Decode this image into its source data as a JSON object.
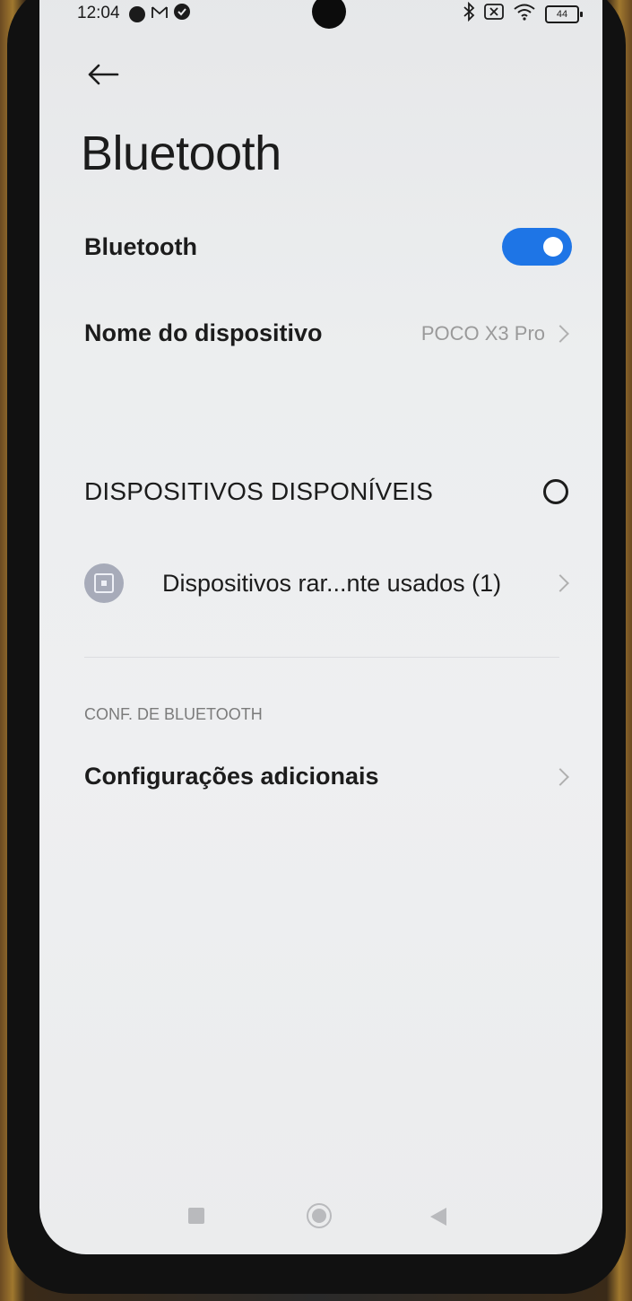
{
  "status_bar": {
    "time": "12:04",
    "battery": "44",
    "icons": [
      "notification-circle-icon",
      "gmail-icon",
      "check-circle-icon",
      "bluetooth-icon",
      "no-sim-icon",
      "wifi-icon",
      "battery-icon"
    ]
  },
  "header": {
    "back_icon": "back-arrow-icon",
    "title": "Bluetooth"
  },
  "bluetooth_row": {
    "label": "Bluetooth",
    "toggle_on": true,
    "toggle_color": "#1e75e6"
  },
  "device_name_row": {
    "label": "Nome do dispositivo",
    "value": "POCO X3 Pro"
  },
  "available_section": {
    "title": "DISPOSITIVOS DISPONÍVEIS",
    "device_item": {
      "label": "Dispositivos rar...nte usados (1)"
    }
  },
  "settings_section": {
    "title": "CONF. DE BLUETOOTH",
    "items": [
      {
        "label": "Configurações adicionais"
      }
    ]
  },
  "nav_bar": {
    "buttons": [
      "recents-button",
      "home-button",
      "back-button"
    ]
  }
}
